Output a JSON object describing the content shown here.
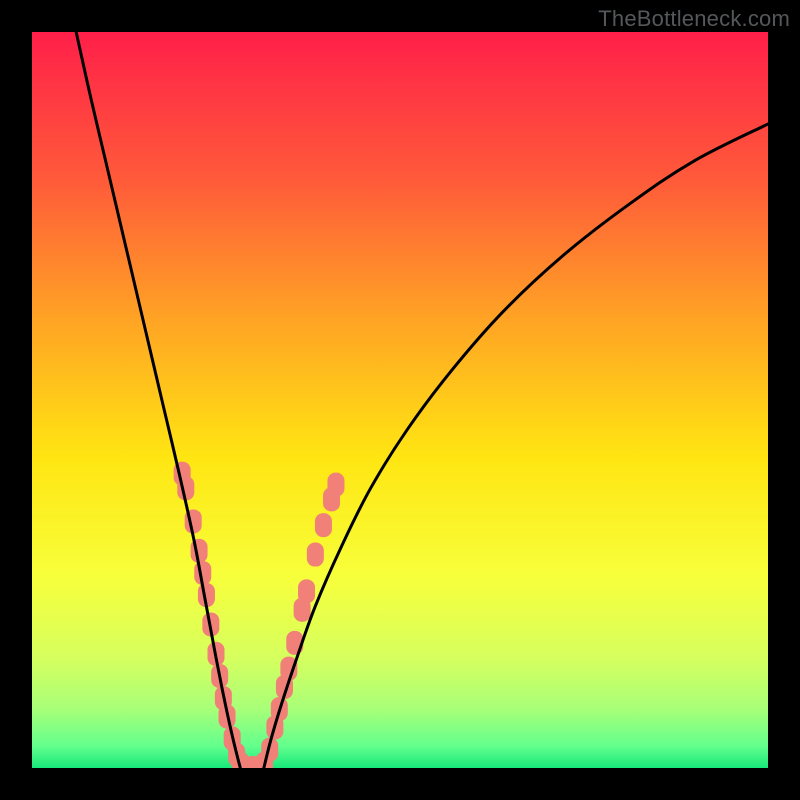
{
  "watermark": "TheBottleneck.com",
  "chart_data": {
    "type": "line",
    "title": "",
    "xlabel": "",
    "ylabel": "",
    "xlim": [
      0,
      100
    ],
    "ylim": [
      0,
      100
    ],
    "grid": false,
    "legend": false,
    "gradient_stops": [
      {
        "offset": 0.0,
        "color": "#ff1f49"
      },
      {
        "offset": 0.2,
        "color": "#ff5a3a"
      },
      {
        "offset": 0.4,
        "color": "#ffa723"
      },
      {
        "offset": 0.58,
        "color": "#ffe612"
      },
      {
        "offset": 0.74,
        "color": "#f7ff3b"
      },
      {
        "offset": 0.85,
        "color": "#d6ff5e"
      },
      {
        "offset": 0.92,
        "color": "#a8ff78"
      },
      {
        "offset": 0.97,
        "color": "#63ff8d"
      },
      {
        "offset": 1.0,
        "color": "#17e87a"
      }
    ],
    "series": [
      {
        "name": "left-curve",
        "x": [
          6,
          8,
          10,
          12,
          14,
          16,
          18,
          20,
          22,
          23.5,
          25,
          26.2,
          27.3,
          28.3
        ],
        "y": [
          100,
          91,
          82.5,
          74,
          65.5,
          57,
          48.5,
          40,
          31,
          23,
          15,
          9,
          4,
          0
        ]
      },
      {
        "name": "right-curve",
        "x": [
          31.5,
          32.5,
          34,
          36,
          38.5,
          42,
          46,
          51,
          57,
          64,
          72,
          81,
          90,
          100
        ],
        "y": [
          0,
          4,
          9,
          15,
          22,
          30,
          38,
          46,
          54,
          62,
          69.5,
          76.5,
          82.5,
          87.5
        ]
      }
    ],
    "scatter_points": {
      "name": "highlighted-points",
      "color": "#f08078",
      "points": [
        {
          "x": 20.4,
          "y": 40.0
        },
        {
          "x": 20.9,
          "y": 38.0
        },
        {
          "x": 21.9,
          "y": 33.5
        },
        {
          "x": 22.7,
          "y": 29.5
        },
        {
          "x": 23.2,
          "y": 26.5
        },
        {
          "x": 23.7,
          "y": 23.5
        },
        {
          "x": 24.3,
          "y": 19.5
        },
        {
          "x": 25.0,
          "y": 15.5
        },
        {
          "x": 25.5,
          "y": 12.5
        },
        {
          "x": 26.0,
          "y": 9.5
        },
        {
          "x": 26.5,
          "y": 7.0
        },
        {
          "x": 27.2,
          "y": 4.0
        },
        {
          "x": 27.8,
          "y": 1.8
        },
        {
          "x": 28.3,
          "y": 0.6
        },
        {
          "x": 29.0,
          "y": 0.0
        },
        {
          "x": 30.0,
          "y": 0.0
        },
        {
          "x": 30.8,
          "y": 0.0
        },
        {
          "x": 31.6,
          "y": 0.6
        },
        {
          "x": 32.3,
          "y": 2.5
        },
        {
          "x": 33.0,
          "y": 5.5
        },
        {
          "x": 33.6,
          "y": 8.0
        },
        {
          "x": 34.3,
          "y": 11.0
        },
        {
          "x": 34.9,
          "y": 13.5
        },
        {
          "x": 35.7,
          "y": 17.0
        },
        {
          "x": 36.7,
          "y": 21.5
        },
        {
          "x": 37.3,
          "y": 24.0
        },
        {
          "x": 38.5,
          "y": 29.0
        },
        {
          "x": 39.6,
          "y": 33.0
        },
        {
          "x": 40.7,
          "y": 36.5
        },
        {
          "x": 41.3,
          "y": 38.5
        }
      ]
    }
  }
}
